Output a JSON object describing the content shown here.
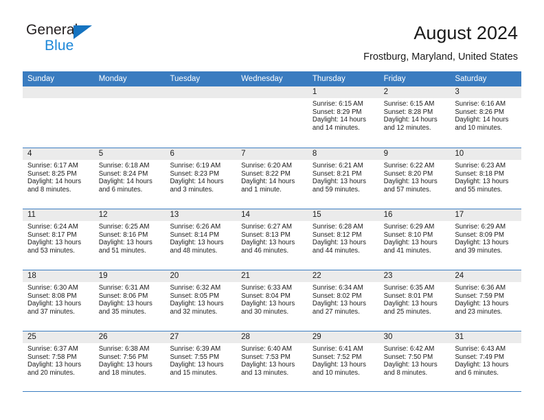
{
  "brand": {
    "name_part1": "General",
    "name_part2": "Blue",
    "accent_color": "#1d87d8",
    "triangle_color": "#1573c0"
  },
  "header": {
    "title": "August 2024",
    "subtitle": "Frostburg, Maryland, United States"
  },
  "calendar": {
    "header_bg": "#3a7cc0",
    "daynum_bg": "#ebebeb",
    "weekdays": [
      "Sunday",
      "Monday",
      "Tuesday",
      "Wednesday",
      "Thursday",
      "Friday",
      "Saturday"
    ],
    "weeks": [
      [
        {
          "day": "",
          "sunrise": "",
          "sunset": "",
          "daylight1": "",
          "daylight2": ""
        },
        {
          "day": "",
          "sunrise": "",
          "sunset": "",
          "daylight1": "",
          "daylight2": ""
        },
        {
          "day": "",
          "sunrise": "",
          "sunset": "",
          "daylight1": "",
          "daylight2": ""
        },
        {
          "day": "",
          "sunrise": "",
          "sunset": "",
          "daylight1": "",
          "daylight2": ""
        },
        {
          "day": "1",
          "sunrise": "Sunrise: 6:15 AM",
          "sunset": "Sunset: 8:29 PM",
          "daylight1": "Daylight: 14 hours",
          "daylight2": "and 14 minutes."
        },
        {
          "day": "2",
          "sunrise": "Sunrise: 6:15 AM",
          "sunset": "Sunset: 8:28 PM",
          "daylight1": "Daylight: 14 hours",
          "daylight2": "and 12 minutes."
        },
        {
          "day": "3",
          "sunrise": "Sunrise: 6:16 AM",
          "sunset": "Sunset: 8:26 PM",
          "daylight1": "Daylight: 14 hours",
          "daylight2": "and 10 minutes."
        }
      ],
      [
        {
          "day": "4",
          "sunrise": "Sunrise: 6:17 AM",
          "sunset": "Sunset: 8:25 PM",
          "daylight1": "Daylight: 14 hours",
          "daylight2": "and 8 minutes."
        },
        {
          "day": "5",
          "sunrise": "Sunrise: 6:18 AM",
          "sunset": "Sunset: 8:24 PM",
          "daylight1": "Daylight: 14 hours",
          "daylight2": "and 6 minutes."
        },
        {
          "day": "6",
          "sunrise": "Sunrise: 6:19 AM",
          "sunset": "Sunset: 8:23 PM",
          "daylight1": "Daylight: 14 hours",
          "daylight2": "and 3 minutes."
        },
        {
          "day": "7",
          "sunrise": "Sunrise: 6:20 AM",
          "sunset": "Sunset: 8:22 PM",
          "daylight1": "Daylight: 14 hours",
          "daylight2": "and 1 minute."
        },
        {
          "day": "8",
          "sunrise": "Sunrise: 6:21 AM",
          "sunset": "Sunset: 8:21 PM",
          "daylight1": "Daylight: 13 hours",
          "daylight2": "and 59 minutes."
        },
        {
          "day": "9",
          "sunrise": "Sunrise: 6:22 AM",
          "sunset": "Sunset: 8:20 PM",
          "daylight1": "Daylight: 13 hours",
          "daylight2": "and 57 minutes."
        },
        {
          "day": "10",
          "sunrise": "Sunrise: 6:23 AM",
          "sunset": "Sunset: 8:18 PM",
          "daylight1": "Daylight: 13 hours",
          "daylight2": "and 55 minutes."
        }
      ],
      [
        {
          "day": "11",
          "sunrise": "Sunrise: 6:24 AM",
          "sunset": "Sunset: 8:17 PM",
          "daylight1": "Daylight: 13 hours",
          "daylight2": "and 53 minutes."
        },
        {
          "day": "12",
          "sunrise": "Sunrise: 6:25 AM",
          "sunset": "Sunset: 8:16 PM",
          "daylight1": "Daylight: 13 hours",
          "daylight2": "and 51 minutes."
        },
        {
          "day": "13",
          "sunrise": "Sunrise: 6:26 AM",
          "sunset": "Sunset: 8:14 PM",
          "daylight1": "Daylight: 13 hours",
          "daylight2": "and 48 minutes."
        },
        {
          "day": "14",
          "sunrise": "Sunrise: 6:27 AM",
          "sunset": "Sunset: 8:13 PM",
          "daylight1": "Daylight: 13 hours",
          "daylight2": "and 46 minutes."
        },
        {
          "day": "15",
          "sunrise": "Sunrise: 6:28 AM",
          "sunset": "Sunset: 8:12 PM",
          "daylight1": "Daylight: 13 hours",
          "daylight2": "and 44 minutes."
        },
        {
          "day": "16",
          "sunrise": "Sunrise: 6:29 AM",
          "sunset": "Sunset: 8:10 PM",
          "daylight1": "Daylight: 13 hours",
          "daylight2": "and 41 minutes."
        },
        {
          "day": "17",
          "sunrise": "Sunrise: 6:29 AM",
          "sunset": "Sunset: 8:09 PM",
          "daylight1": "Daylight: 13 hours",
          "daylight2": "and 39 minutes."
        }
      ],
      [
        {
          "day": "18",
          "sunrise": "Sunrise: 6:30 AM",
          "sunset": "Sunset: 8:08 PM",
          "daylight1": "Daylight: 13 hours",
          "daylight2": "and 37 minutes."
        },
        {
          "day": "19",
          "sunrise": "Sunrise: 6:31 AM",
          "sunset": "Sunset: 8:06 PM",
          "daylight1": "Daylight: 13 hours",
          "daylight2": "and 35 minutes."
        },
        {
          "day": "20",
          "sunrise": "Sunrise: 6:32 AM",
          "sunset": "Sunset: 8:05 PM",
          "daylight1": "Daylight: 13 hours",
          "daylight2": "and 32 minutes."
        },
        {
          "day": "21",
          "sunrise": "Sunrise: 6:33 AM",
          "sunset": "Sunset: 8:04 PM",
          "daylight1": "Daylight: 13 hours",
          "daylight2": "and 30 minutes."
        },
        {
          "day": "22",
          "sunrise": "Sunrise: 6:34 AM",
          "sunset": "Sunset: 8:02 PM",
          "daylight1": "Daylight: 13 hours",
          "daylight2": "and 27 minutes."
        },
        {
          "day": "23",
          "sunrise": "Sunrise: 6:35 AM",
          "sunset": "Sunset: 8:01 PM",
          "daylight1": "Daylight: 13 hours",
          "daylight2": "and 25 minutes."
        },
        {
          "day": "24",
          "sunrise": "Sunrise: 6:36 AM",
          "sunset": "Sunset: 7:59 PM",
          "daylight1": "Daylight: 13 hours",
          "daylight2": "and 23 minutes."
        }
      ],
      [
        {
          "day": "25",
          "sunrise": "Sunrise: 6:37 AM",
          "sunset": "Sunset: 7:58 PM",
          "daylight1": "Daylight: 13 hours",
          "daylight2": "and 20 minutes."
        },
        {
          "day": "26",
          "sunrise": "Sunrise: 6:38 AM",
          "sunset": "Sunset: 7:56 PM",
          "daylight1": "Daylight: 13 hours",
          "daylight2": "and 18 minutes."
        },
        {
          "day": "27",
          "sunrise": "Sunrise: 6:39 AM",
          "sunset": "Sunset: 7:55 PM",
          "daylight1": "Daylight: 13 hours",
          "daylight2": "and 15 minutes."
        },
        {
          "day": "28",
          "sunrise": "Sunrise: 6:40 AM",
          "sunset": "Sunset: 7:53 PM",
          "daylight1": "Daylight: 13 hours",
          "daylight2": "and 13 minutes."
        },
        {
          "day": "29",
          "sunrise": "Sunrise: 6:41 AM",
          "sunset": "Sunset: 7:52 PM",
          "daylight1": "Daylight: 13 hours",
          "daylight2": "and 10 minutes."
        },
        {
          "day": "30",
          "sunrise": "Sunrise: 6:42 AM",
          "sunset": "Sunset: 7:50 PM",
          "daylight1": "Daylight: 13 hours",
          "daylight2": "and 8 minutes."
        },
        {
          "day": "31",
          "sunrise": "Sunrise: 6:43 AM",
          "sunset": "Sunset: 7:49 PM",
          "daylight1": "Daylight: 13 hours",
          "daylight2": "and 6 minutes."
        }
      ]
    ]
  }
}
